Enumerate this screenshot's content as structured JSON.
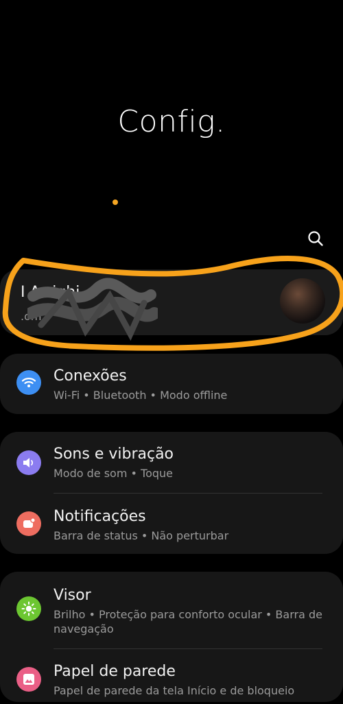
{
  "header": {
    "title": "Config."
  },
  "search": {
    "icon": "search-icon"
  },
  "account": {
    "name": "I    Arrighi",
    "email": "                    .om"
  },
  "items": [
    {
      "title": "Conexões",
      "subtitle": "Wi-Fi  •  Bluetooth  •  Modo offline",
      "icon": "wifi-icon",
      "color": "#3d8ff3"
    },
    {
      "title": "Sons e vibração",
      "subtitle": "Modo de som  •  Toque",
      "icon": "volume-icon",
      "color": "#8b7cf0"
    },
    {
      "title": "Notificações",
      "subtitle": "Barra de status  •  Não perturbar",
      "icon": "notification-icon",
      "color": "#ee6d60"
    },
    {
      "title": "Visor",
      "subtitle": "Brilho  •  Proteção para conforto ocular  •  Barra de navegação",
      "icon": "brightness-icon",
      "color": "#6cc631"
    },
    {
      "title": "Papel de parede",
      "subtitle": "Papel de parede da tela Início e de bloqueio",
      "icon": "wallpaper-icon",
      "color": "#ea5f86"
    }
  ],
  "colors": {
    "accent_orange": "#f7a21b",
    "page_dot": "#f5a623"
  }
}
